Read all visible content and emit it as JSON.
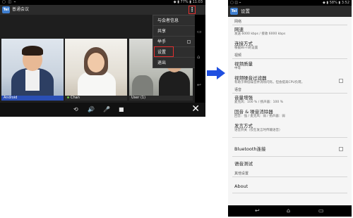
{
  "tablet": {
    "status": {
      "left_icons": "▢ ◫ ⌁",
      "right": "◆ ▮ 77% ▮ 11:03"
    },
    "app_title": "普通会议",
    "app_icon_text": "Tel",
    "menu_button_glyph": "⋮",
    "menu": {
      "items": [
        {
          "label": "与会者信息"
        },
        {
          "label": "共享"
        },
        {
          "label": "举手"
        },
        {
          "label": "设置"
        },
        {
          "label": "退出"
        }
      ]
    },
    "videos": [
      {
        "label": "Android"
      },
      {
        "label": "Chan"
      },
      {
        "label": "User (1)"
      }
    ],
    "toolbar": {
      "camera_switch": "⟲",
      "speaker": "🔊",
      "mic": "🎤",
      "video": "■",
      "close": "✕"
    },
    "nav": {
      "back": "↩",
      "home": "⌂",
      "recent": "▭"
    }
  },
  "phone": {
    "status": {
      "left_icons": "▢ ◫ ⌁",
      "right": "◆ ▮ 58% ▮ 3:52"
    },
    "app_title": "设置",
    "app_icon_text": "Tel",
    "sections": {
      "network": "网络",
      "video": "视频",
      "audio": "语音",
      "other": "其他设置"
    },
    "items": {
      "bandwidth": {
        "title": "网速",
        "sub": "发送 6000 kbps / 接收 6000 kbps"
      },
      "connect_mode": {
        "title": "连接方式",
        "sub": "根据Wi-Fi的设置"
      },
      "video_quality": {
        "title": "视频质量",
        "sub": "中等"
      },
      "video_noise": {
        "title": "视频噪音过滤器",
        "sub": "有助于降低噪音并消除闪烁。但会提高CPU负荷。"
      },
      "volume_boost": {
        "title": "音量增强",
        "sub": "麦克风：100 % / 扬声器：100 %"
      },
      "echo_cancel": {
        "title": "回音 & 噪音消除器",
        "sub": "回音：强 / 麦克风：弱 / 扬声器：弱"
      },
      "speak_mode": {
        "title": "发言方式",
        "sub": "语音开关（仅在发言时传输语音）"
      },
      "bluetooth": {
        "title": "Bluetooth连接"
      },
      "voice_test": {
        "title": "语音测试"
      },
      "about": {
        "title": "About"
      }
    },
    "nav": {
      "back": "↩",
      "home": "⌂",
      "recent": "▭"
    }
  },
  "colors": {
    "arrow": "#1f4fe0",
    "highlight_box": "#e53030",
    "name_bar": "#2a4fb5"
  }
}
